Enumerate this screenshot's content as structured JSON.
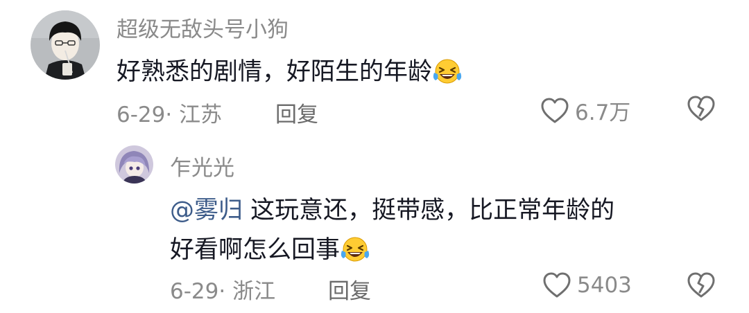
{
  "comments": [
    {
      "username": "超级无敌头号小狗",
      "text": "好熟悉的剧情，好陌生的年龄",
      "emoji": "grinning-squinting-tears-emoji",
      "date": "6-29",
      "location": "江苏",
      "reply_label": "回复",
      "likes": "6.7万"
    },
    {
      "username": "乍光光",
      "mention": "@雾归",
      "text_line1": " 这玩意还，挺带感，比正常年龄的",
      "text_line2": "好看啊怎么回事",
      "emoji": "grinning-squinting-tears-emoji",
      "date": "6-29",
      "location": "浙江",
      "reply_label": "回复",
      "likes": "5403"
    }
  ],
  "colors": {
    "username": "#8a8a8a",
    "text": "#161823",
    "mention": "#3d5c8a",
    "meta": "#8a8a8a"
  },
  "icons": {
    "like": "heart-outline-icon",
    "dislike": "broken-heart-outline-icon"
  }
}
